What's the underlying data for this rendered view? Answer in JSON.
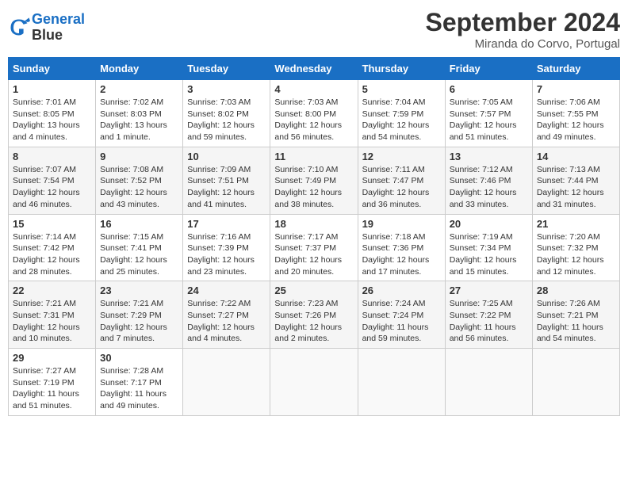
{
  "header": {
    "logo_line1": "General",
    "logo_line2": "Blue",
    "month": "September 2024",
    "location": "Miranda do Corvo, Portugal"
  },
  "weekdays": [
    "Sunday",
    "Monday",
    "Tuesday",
    "Wednesday",
    "Thursday",
    "Friday",
    "Saturday"
  ],
  "weeks": [
    [
      {
        "day": "1",
        "lines": [
          "Sunrise: 7:01 AM",
          "Sunset: 8:05 PM",
          "Daylight: 13 hours",
          "and 4 minutes."
        ]
      },
      {
        "day": "2",
        "lines": [
          "Sunrise: 7:02 AM",
          "Sunset: 8:03 PM",
          "Daylight: 13 hours",
          "and 1 minute."
        ]
      },
      {
        "day": "3",
        "lines": [
          "Sunrise: 7:03 AM",
          "Sunset: 8:02 PM",
          "Daylight: 12 hours",
          "and 59 minutes."
        ]
      },
      {
        "day": "4",
        "lines": [
          "Sunrise: 7:03 AM",
          "Sunset: 8:00 PM",
          "Daylight: 12 hours",
          "and 56 minutes."
        ]
      },
      {
        "day": "5",
        "lines": [
          "Sunrise: 7:04 AM",
          "Sunset: 7:59 PM",
          "Daylight: 12 hours",
          "and 54 minutes."
        ]
      },
      {
        "day": "6",
        "lines": [
          "Sunrise: 7:05 AM",
          "Sunset: 7:57 PM",
          "Daylight: 12 hours",
          "and 51 minutes."
        ]
      },
      {
        "day": "7",
        "lines": [
          "Sunrise: 7:06 AM",
          "Sunset: 7:55 PM",
          "Daylight: 12 hours",
          "and 49 minutes."
        ]
      }
    ],
    [
      {
        "day": "8",
        "lines": [
          "Sunrise: 7:07 AM",
          "Sunset: 7:54 PM",
          "Daylight: 12 hours",
          "and 46 minutes."
        ]
      },
      {
        "day": "9",
        "lines": [
          "Sunrise: 7:08 AM",
          "Sunset: 7:52 PM",
          "Daylight: 12 hours",
          "and 43 minutes."
        ]
      },
      {
        "day": "10",
        "lines": [
          "Sunrise: 7:09 AM",
          "Sunset: 7:51 PM",
          "Daylight: 12 hours",
          "and 41 minutes."
        ]
      },
      {
        "day": "11",
        "lines": [
          "Sunrise: 7:10 AM",
          "Sunset: 7:49 PM",
          "Daylight: 12 hours",
          "and 38 minutes."
        ]
      },
      {
        "day": "12",
        "lines": [
          "Sunrise: 7:11 AM",
          "Sunset: 7:47 PM",
          "Daylight: 12 hours",
          "and 36 minutes."
        ]
      },
      {
        "day": "13",
        "lines": [
          "Sunrise: 7:12 AM",
          "Sunset: 7:46 PM",
          "Daylight: 12 hours",
          "and 33 minutes."
        ]
      },
      {
        "day": "14",
        "lines": [
          "Sunrise: 7:13 AM",
          "Sunset: 7:44 PM",
          "Daylight: 12 hours",
          "and 31 minutes."
        ]
      }
    ],
    [
      {
        "day": "15",
        "lines": [
          "Sunrise: 7:14 AM",
          "Sunset: 7:42 PM",
          "Daylight: 12 hours",
          "and 28 minutes."
        ]
      },
      {
        "day": "16",
        "lines": [
          "Sunrise: 7:15 AM",
          "Sunset: 7:41 PM",
          "Daylight: 12 hours",
          "and 25 minutes."
        ]
      },
      {
        "day": "17",
        "lines": [
          "Sunrise: 7:16 AM",
          "Sunset: 7:39 PM",
          "Daylight: 12 hours",
          "and 23 minutes."
        ]
      },
      {
        "day": "18",
        "lines": [
          "Sunrise: 7:17 AM",
          "Sunset: 7:37 PM",
          "Daylight: 12 hours",
          "and 20 minutes."
        ]
      },
      {
        "day": "19",
        "lines": [
          "Sunrise: 7:18 AM",
          "Sunset: 7:36 PM",
          "Daylight: 12 hours",
          "and 17 minutes."
        ]
      },
      {
        "day": "20",
        "lines": [
          "Sunrise: 7:19 AM",
          "Sunset: 7:34 PM",
          "Daylight: 12 hours",
          "and 15 minutes."
        ]
      },
      {
        "day": "21",
        "lines": [
          "Sunrise: 7:20 AM",
          "Sunset: 7:32 PM",
          "Daylight: 12 hours",
          "and 12 minutes."
        ]
      }
    ],
    [
      {
        "day": "22",
        "lines": [
          "Sunrise: 7:21 AM",
          "Sunset: 7:31 PM",
          "Daylight: 12 hours",
          "and 10 minutes."
        ]
      },
      {
        "day": "23",
        "lines": [
          "Sunrise: 7:21 AM",
          "Sunset: 7:29 PM",
          "Daylight: 12 hours",
          "and 7 minutes."
        ]
      },
      {
        "day": "24",
        "lines": [
          "Sunrise: 7:22 AM",
          "Sunset: 7:27 PM",
          "Daylight: 12 hours",
          "and 4 minutes."
        ]
      },
      {
        "day": "25",
        "lines": [
          "Sunrise: 7:23 AM",
          "Sunset: 7:26 PM",
          "Daylight: 12 hours",
          "and 2 minutes."
        ]
      },
      {
        "day": "26",
        "lines": [
          "Sunrise: 7:24 AM",
          "Sunset: 7:24 PM",
          "Daylight: 11 hours",
          "and 59 minutes."
        ]
      },
      {
        "day": "27",
        "lines": [
          "Sunrise: 7:25 AM",
          "Sunset: 7:22 PM",
          "Daylight: 11 hours",
          "and 56 minutes."
        ]
      },
      {
        "day": "28",
        "lines": [
          "Sunrise: 7:26 AM",
          "Sunset: 7:21 PM",
          "Daylight: 11 hours",
          "and 54 minutes."
        ]
      }
    ],
    [
      {
        "day": "29",
        "lines": [
          "Sunrise: 7:27 AM",
          "Sunset: 7:19 PM",
          "Daylight: 11 hours",
          "and 51 minutes."
        ]
      },
      {
        "day": "30",
        "lines": [
          "Sunrise: 7:28 AM",
          "Sunset: 7:17 PM",
          "Daylight: 11 hours",
          "and 49 minutes."
        ]
      },
      null,
      null,
      null,
      null,
      null
    ]
  ]
}
